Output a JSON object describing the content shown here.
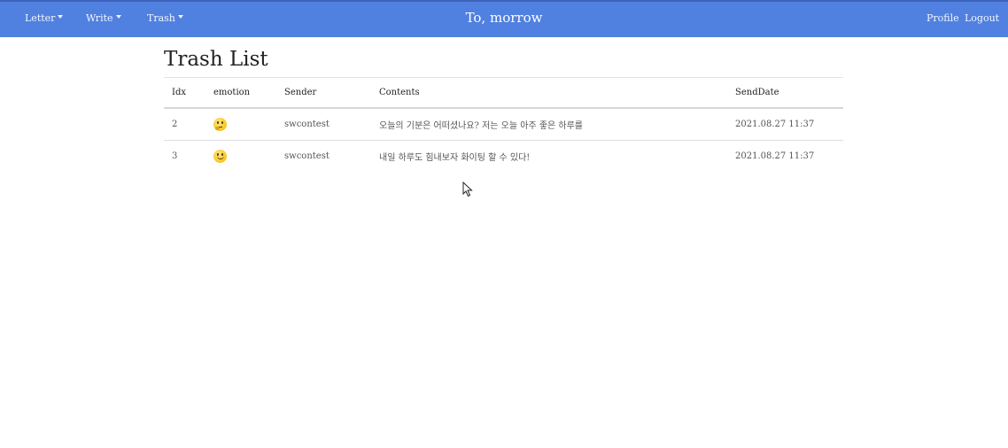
{
  "navbar": {
    "menus": [
      {
        "label": "Letter"
      },
      {
        "label": "Write"
      },
      {
        "label": "Trash"
      }
    ],
    "brand": "To, morrow",
    "profile": "Profile",
    "logout": "Logout",
    "color": "#5080e0"
  },
  "page": {
    "title": "Trash List"
  },
  "table": {
    "headers": [
      "Idx",
      "emotion",
      "Sender",
      "Contents",
      "SendDate"
    ],
    "rows": [
      {
        "idx": "2",
        "emotion_icon": "thinking-face-icon",
        "sender": "swcontest",
        "contents": "오늘의 기분은 어떠셨나요? 저는 오늘 아주 좋은 하루를",
        "date": "2021.08.27 11:37"
      },
      {
        "idx": "3",
        "emotion_icon": "smiling-face-icon",
        "sender": "swcontest",
        "contents": "내일 하루도 힘내보자 화이팅 할 수 있다!",
        "date": "2021.08.27 11:37"
      }
    ]
  }
}
